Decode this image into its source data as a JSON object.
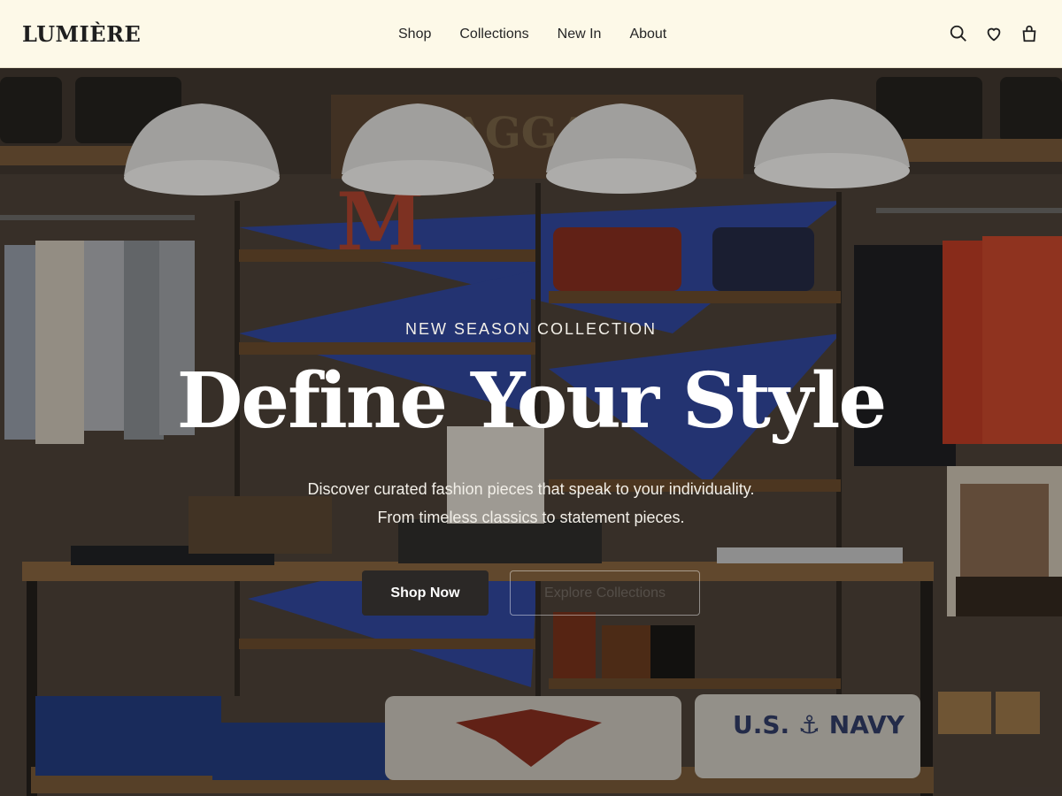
{
  "brand": {
    "logo": "LUMIÈRE"
  },
  "nav": {
    "items": [
      "Shop",
      "Collections",
      "New In",
      "About"
    ]
  },
  "header_icons": [
    "search-icon",
    "heart-icon",
    "bag-icon"
  ],
  "hero": {
    "eyebrow": "NEW SEASON COLLECTION",
    "headline": "Define Your Style",
    "subtitle_line1": "Discover curated fashion pieces that speak to your individuality.",
    "subtitle_line2": "From timeless classics to statement pieces.",
    "primary_cta": "Shop Now",
    "secondary_cta": "Explore Collections"
  },
  "scene_text": {
    "sign": "BAGGAGE",
    "shirt_print": "U.S. ⚓ NAVY",
    "letter": "M"
  },
  "colors": {
    "header_bg": "#fdf9e8",
    "text_dark": "#1f1f1f",
    "button_primary": "#2b2826",
    "accent_blue": "#2b45a8"
  }
}
